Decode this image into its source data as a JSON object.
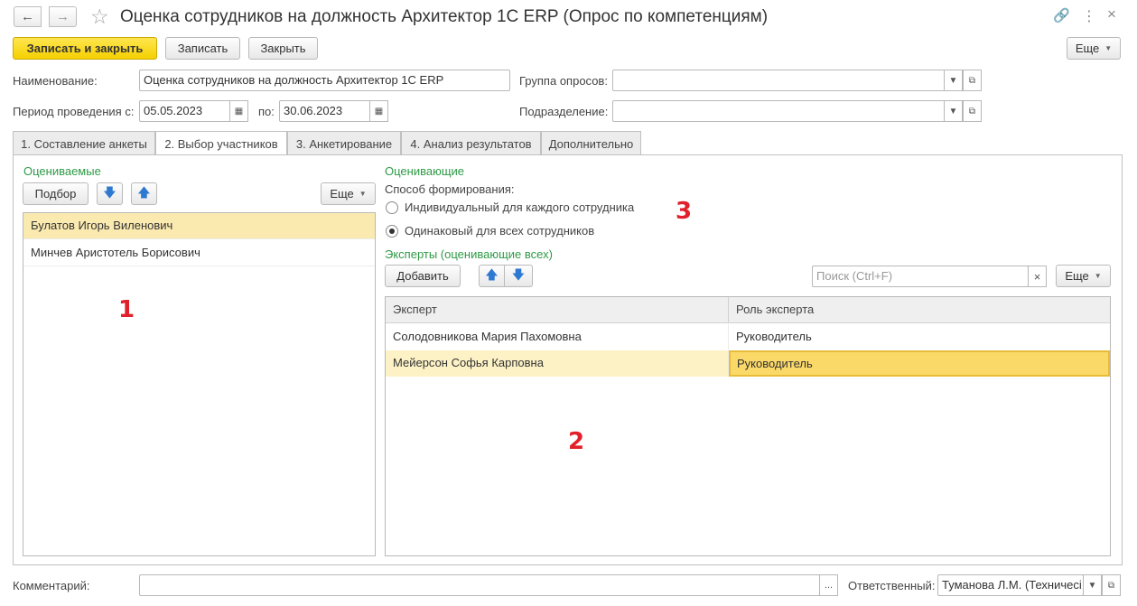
{
  "window": {
    "title": "Оценка сотрудников на должность Архитектор 1С ERP (Опрос по компетенциям)"
  },
  "toolbar": {
    "save_close": "Записать и закрыть",
    "save": "Записать",
    "close": "Закрыть",
    "more": "Еще"
  },
  "fields": {
    "name_label": "Наименование:",
    "name_value": "Оценка сотрудников на должность Архитектор 1С ERP",
    "group_label": "Группа опросов:",
    "group_value": "",
    "period_label": "Период проведения с:",
    "period_from": "05.05.2023",
    "period_to_label": "по:",
    "period_to": "30.06.2023",
    "dept_label": "Подразделение:",
    "dept_value": ""
  },
  "tabs": [
    {
      "label": "1. Составление анкеты"
    },
    {
      "label": "2. Выбор участников"
    },
    {
      "label": "3. Анкетирование"
    },
    {
      "label": "4. Анализ результатов"
    },
    {
      "label": "Дополнительно"
    }
  ],
  "left": {
    "header": "Оцениваемые",
    "pick_btn": "Подбор",
    "more": "Еще",
    "rows": [
      {
        "name": "Булатов Игорь Виленович"
      },
      {
        "name": "Минчев Аристотель Борисович"
      }
    ],
    "marker": "1"
  },
  "right": {
    "header": "Оценивающие",
    "method_label": "Способ формирования:",
    "option1": "Индивидуальный для каждого сотрудника",
    "option2": "Одинаковый для всех сотрудников",
    "selected_option": 2,
    "experts_header": "Эксперты (оценивающие всех)",
    "add_btn": "Добавить",
    "search_placeholder": "Поиск (Ctrl+F)",
    "more": "Еще",
    "columns": [
      "Эксперт",
      "Роль эксперта"
    ],
    "rows": [
      {
        "expert": "Солодовникова Мария Пахомовна",
        "role": "Руководитель"
      },
      {
        "expert": "Мейерсон Софья Карповна",
        "role": "Руководитель"
      }
    ],
    "marker_grid": "2",
    "marker_method": "3"
  },
  "footer": {
    "comment_label": "Комментарий:",
    "comment_value": "",
    "responsible_label": "Ответственный:",
    "responsible_value": "Туманова Л.М. (Техничесі"
  },
  "colors": {
    "primary_button": "#f5d000",
    "group_header": "#2e9a46",
    "selection": "#fbeab0",
    "marker": "#e0202a"
  }
}
